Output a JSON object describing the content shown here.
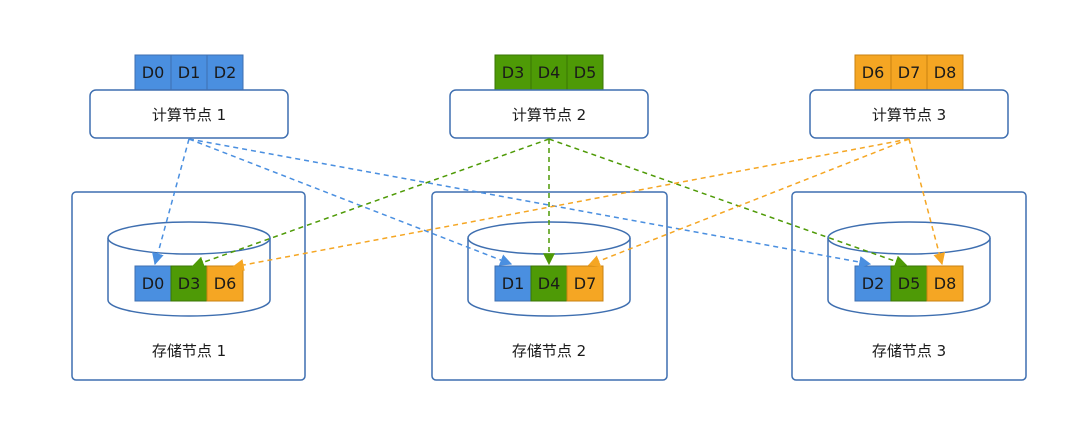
{
  "colors": {
    "blue": "#4A8FE0",
    "green": "#4E9A06",
    "orange": "#F5A623",
    "border": "#3F6FB0",
    "text": "#1a1a1a"
  },
  "compute_nodes": [
    {
      "label": "计算节点 1",
      "color": "blue",
      "blocks": [
        "D0",
        "D1",
        "D2"
      ]
    },
    {
      "label": "计算节点 2",
      "color": "green",
      "blocks": [
        "D3",
        "D4",
        "D5"
      ]
    },
    {
      "label": "计算节点 3",
      "color": "orange",
      "blocks": [
        "D6",
        "D7",
        "D8"
      ]
    }
  ],
  "storage_nodes": [
    {
      "label": "存储节点 1",
      "blocks": [
        {
          "text": "D0",
          "color": "blue"
        },
        {
          "text": "D3",
          "color": "green"
        },
        {
          "text": "D6",
          "color": "orange"
        }
      ]
    },
    {
      "label": "存储节点 2",
      "blocks": [
        {
          "text": "D1",
          "color": "blue"
        },
        {
          "text": "D4",
          "color": "green"
        },
        {
          "text": "D7",
          "color": "orange"
        }
      ]
    },
    {
      "label": "存储节点 3",
      "blocks": [
        {
          "text": "D2",
          "color": "blue"
        },
        {
          "text": "D5",
          "color": "green"
        },
        {
          "text": "D8",
          "color": "orange"
        }
      ]
    }
  ]
}
